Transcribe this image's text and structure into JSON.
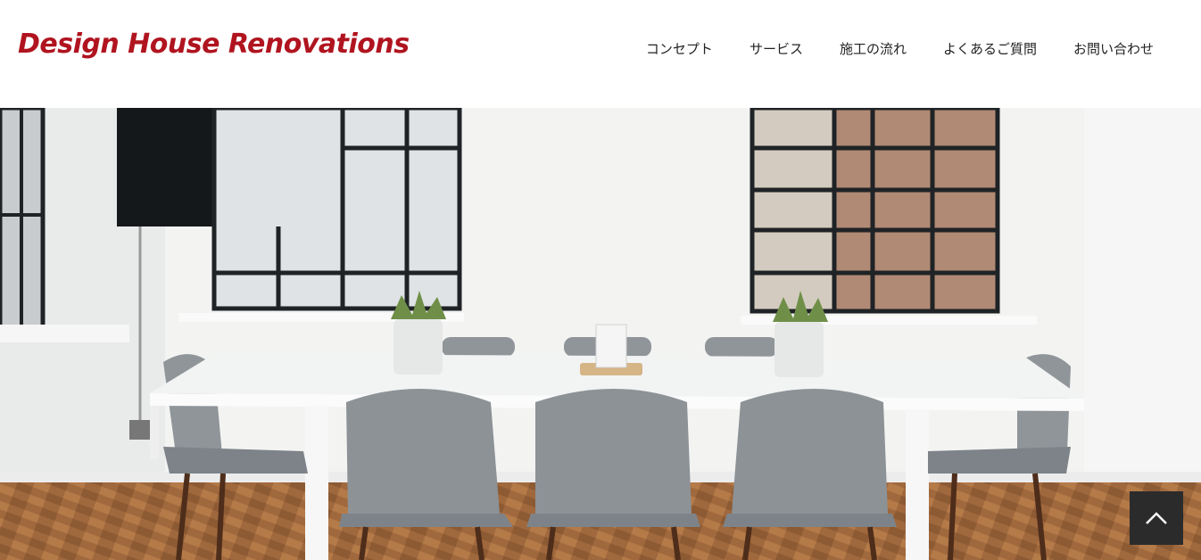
{
  "header": {
    "logo_text": "Design House Renovations",
    "nav_items": [
      {
        "label": "コンセプト"
      },
      {
        "label": "サービス"
      },
      {
        "label": "施工の流れ"
      },
      {
        "label": "よくあるご質問"
      },
      {
        "label": "お問い合わせ"
      }
    ]
  },
  "hero": {
    "image_subject": "white meeting room with gray chairs, table, plants and windows"
  },
  "scroll_to_top": {
    "icon": "chevron-up-icon"
  },
  "colors": {
    "logo": "#b0141f",
    "nav_text": "#222222",
    "to_top_bg": "#2b2b2b"
  }
}
